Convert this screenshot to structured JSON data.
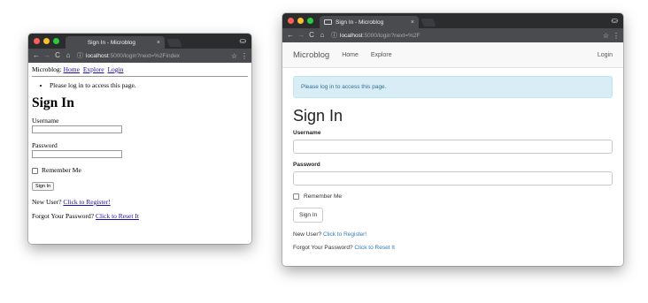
{
  "left": {
    "tab_title": "Sign In - Microblog",
    "url": {
      "host": "localhost",
      "path": ":5000/login?next=%2Findex"
    },
    "nav": {
      "brand": "Microblog:",
      "home": "Home",
      "explore": "Explore",
      "login": "Login"
    },
    "flash": "Please log in to access this page.",
    "heading": "Sign In",
    "username_label": "Username",
    "password_label": "Password",
    "remember_label": "Remember Me",
    "submit_label": "Sign In",
    "register_prefix": "New User?",
    "register_link": "Click to Register!",
    "reset_prefix": "Forgot Your Password?",
    "reset_link": "Click to Reset It"
  },
  "right": {
    "tab_title": "Sign In - Microblog",
    "url": {
      "host": "localhost",
      "path": ":5000/login?next=%2F"
    },
    "nav": {
      "brand": "Microblog",
      "home": "Home",
      "explore": "Explore",
      "login": "Login"
    },
    "flash": "Please log in to access this page.",
    "heading": "Sign In",
    "username_label": "Username",
    "password_label": "Password",
    "remember_label": "Remember Me",
    "submit_label": "Sign In",
    "register_prefix": "New User?",
    "register_link": "Click to Register!",
    "reset_prefix": "Forgot Your Password?",
    "reset_link": "Click to Reset It"
  },
  "chrome": {
    "close_glyph": "×",
    "back_glyph": "←",
    "forward_glyph": "→",
    "reload_glyph": "C",
    "home_glyph": "⌂",
    "info_glyph": "ⓘ",
    "star_glyph": "☆",
    "menu_glyph": "⋮",
    "incognito_glyph": "⛀",
    "icons": [
      "back-arrow-icon",
      "forward-arrow-icon",
      "reload-icon",
      "home-icon",
      "info-icon",
      "star-icon",
      "menu-icon",
      "incognito-icon"
    ]
  },
  "colors": {
    "titlebar": "#2b2c2e",
    "toolbar": "#4a4b4e",
    "link": "#1a0dab",
    "bs_link": "#337ab7",
    "alert_bg": "#d9edf7",
    "alert_text": "#31708f"
  }
}
